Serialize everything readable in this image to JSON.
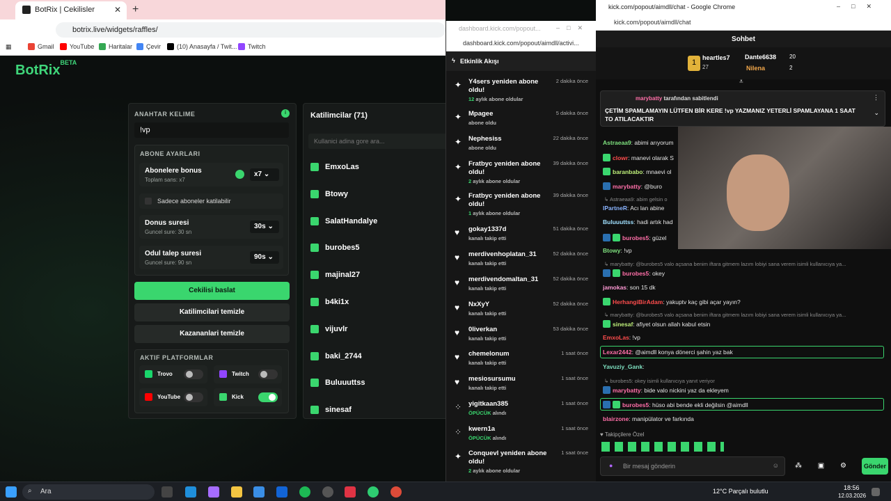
{
  "left": {
    "tab_title": "BotRix | Cekilisler",
    "url": "botrix.live/widgets/raffles/",
    "bookmarks": [
      "Gmail",
      "YouTube",
      "Haritalar",
      "Çevir",
      "(10) Anasayfa / Twit...",
      "Twitch"
    ],
    "logo": "BotRix",
    "logo_sup": "BETA",
    "keyword_label": "ANAHTAR KELIME",
    "keyword_value": "!vp",
    "sub_settings_label": "ABONE AYARLARI",
    "sub_bonus": "Abonelere bonus",
    "sub_bonus_sub": "Toplam sans: x7",
    "sub_bonus_val": "x7",
    "sub_only": "Sadece aboneler katilabilir",
    "duration": "Donus suresi",
    "duration_sub": "Guncel sure: 30 sn",
    "duration_val": "30s",
    "claim": "Odul talep suresi",
    "claim_sub": "Guncel sure: 90 sn",
    "claim_val": "90s",
    "start_btn": "Cekilisi baslat",
    "clear_parts": "Katilimcilari temizle",
    "clear_winners": "Kazananlari temizle",
    "platforms_label": "AKTIF PLATFORMLAR",
    "platforms": [
      {
        "name": "Trovo",
        "on": false
      },
      {
        "name": "Twitch",
        "on": false
      },
      {
        "name": "YouTube",
        "on": false
      },
      {
        "name": "Kick",
        "on": true
      }
    ],
    "participants_title": "Katilimcilar (71)",
    "participants_search": "Kullanici adina gore ara...",
    "participants": [
      "EmxoLas",
      "Btowy",
      "SalatHandalye",
      "burobes5",
      "majinal27",
      "b4ki1x",
      "vijuvlr",
      "baki_2744",
      "Buluuuttss",
      "sinesaf"
    ]
  },
  "activity": {
    "title_bar": "dashboard.kick.com/popout...",
    "url": "dashboard.kick.com/popout/aimdll/activi...",
    "header": "Etkinlik Akışı",
    "events": [
      {
        "icon": "✦",
        "name": "Y4sers yeniden abone oldu!",
        "sub": "12",
        "sub_text": " aylık abone oldular",
        "time": "2 dakika önce"
      },
      {
        "icon": "✦",
        "name": "Mpagee",
        "sub": "",
        "sub_text": "abone oldu",
        "time": "5 dakika önce"
      },
      {
        "icon": "✦",
        "name": "Nephesiss",
        "sub": "",
        "sub_text": "abone oldu",
        "time": "22 dakika önce"
      },
      {
        "icon": "✦",
        "name": "Fratbyc yeniden abone oldu!",
        "sub": "2",
        "sub_text": " aylık abone oldular",
        "time": "39 dakika önce"
      },
      {
        "icon": "✦",
        "name": "Fratbyc yeniden abone oldu!",
        "sub": "1",
        "sub_text": " aylık abone oldular",
        "time": "39 dakika önce"
      },
      {
        "icon": "♥",
        "name": "gokay1337d",
        "sub": "",
        "sub_text": "kanalı takip etti",
        "time": "51 dakika önce"
      },
      {
        "icon": "♥",
        "name": "merdivenhoplatan_31",
        "sub": "",
        "sub_text": "kanalı takip etti",
        "time": "52 dakika önce"
      },
      {
        "icon": "♥",
        "name": "merdivendomaltan_31",
        "sub": "",
        "sub_text": "kanalı takip etti",
        "time": "52 dakika önce"
      },
      {
        "icon": "♥",
        "name": "NxXyY",
        "sub": "",
        "sub_text": "kanalı takip etti",
        "time": "52 dakika önce"
      },
      {
        "icon": "♥",
        "name": "0liverkan",
        "sub": "",
        "sub_text": "kanalı takip etti",
        "time": "53 dakika önce"
      },
      {
        "icon": "♥",
        "name": "chemelonum",
        "sub": "",
        "sub_text": "kanalı takip etti",
        "time": "1 saat önce"
      },
      {
        "icon": "♥",
        "name": "mesiosursumu",
        "sub": "",
        "sub_text": "kanalı takip etti",
        "time": "1 saat önce"
      },
      {
        "icon": "⁘",
        "name": "yigitkaan385",
        "sub": "ÖPÜCÜK",
        "sub_text": " alındı",
        "time": "1 saat önce"
      },
      {
        "icon": "⁘",
        "name": "kwern1a",
        "sub": "ÖPÜCÜK",
        "sub_text": " alındı",
        "time": "1 saat önce"
      },
      {
        "icon": "✦",
        "name": "Conquevl yeniden abone oldu!",
        "sub": "2",
        "sub_text": " aylık abone oldular",
        "time": "1 saat önce"
      }
    ]
  },
  "chat": {
    "title_bar": "kick.com/popout/aimdll/chat - Google Chrome",
    "url": "kick.com/popout/aimdll/chat",
    "header": "Sohbet",
    "leader1": "heartles7",
    "leader1_n": "27",
    "leader2": "Dante6638",
    "leader2_n": "20",
    "leader3": "Nilena",
    "leader3_n": "2",
    "pinned_by": "marybatty",
    "pinned_suffix": "tarafından sabitlendi",
    "pinned_text": "ÇETİM SPAMLAMAYIN LÜTFEN BİR KERE !vp YAZMANIZ YETERLİ SPAMLAYANA 1 SAAT TO ATILACAKTIR",
    "messages": [
      {
        "user": "Astraeaa9",
        "color": "#7ee07e",
        "text": ": abimi arıyorum",
        "badge": ""
      },
      {
        "user": "clowr",
        "color": "#ff4d4d",
        "text": ": manevi olarak S",
        "badge": "g"
      },
      {
        "user": "baranbabo",
        "color": "#bff07a",
        "text": ": mnaevi ol",
        "badge": "g"
      },
      {
        "user": "marybatty",
        "color": "#ff6fa8",
        "text": ": @buro",
        "badge": "b"
      },
      {
        "user": "",
        "color": "",
        "text": "↳ Astraeaa9: abim gelsin o",
        "badge": "reply"
      },
      {
        "user": "lPartneR",
        "color": "#8ab4ff",
        "text": ": Acı lan abine",
        "badge": ""
      },
      {
        "user": "Buluuuttss",
        "color": "#a0e0ff",
        "text": ": hadi artık had",
        "badge": ""
      },
      {
        "user": "burobes5",
        "color": "#ff6fa8",
        "text": ": güzel",
        "badge": "bg"
      },
      {
        "user": "Btowy",
        "color": "#7ee07e",
        "text": ": !vp",
        "badge": ""
      },
      {
        "user": "",
        "color": "",
        "text": "↳ marybatty: @burobes5 valo açsana benim iftara gitmem lazım lobiyi sana verem isimli kullanıcıya ya...",
        "badge": "reply"
      },
      {
        "user": "burobes5",
        "color": "#ff6fa8",
        "text": ": okey",
        "badge": "bg"
      },
      {
        "user": "jamokas",
        "color": "#ff9ad5",
        "text": ": son 15 dk",
        "badge": ""
      },
      {
        "user": "HerhangiBirAdam",
        "color": "#ff4d4d",
        "text": ": yakuptv kaç gibi açar yayın?",
        "badge": "g"
      },
      {
        "user": "",
        "color": "",
        "text": "↳ marybatty: @burobes5 valo açsana benim iftara gitmem lazım lobiyi sana verem isimli kullanıcıya ya...",
        "badge": "reply"
      },
      {
        "user": "sinesaf",
        "color": "#bff07a",
        "text": ": afiyet olsun allah kabul etsin",
        "badge": "g"
      },
      {
        "user": "EmxoLas",
        "color": "#ff4d4d",
        "text": ": !vp",
        "badge": ""
      },
      {
        "user": "Lexar2442",
        "color": "#ff6fa8",
        "text": ": @aimdll konya dönerci şahin yaz bak",
        "badge": "hl"
      },
      {
        "user": "Yavuziy_Gank",
        "color": "#7ee0c0",
        "text": ":",
        "badge": ""
      },
      {
        "user": "",
        "color": "",
        "text": "↳ burobes5: okey isimli kullanıcıya yanıt veriyor",
        "badge": "reply"
      },
      {
        "user": "marybatty",
        "color": "#ff6fa8",
        "text": ": bide valo nickini yaz da ekleyem",
        "badge": "b"
      },
      {
        "user": "burobes5",
        "color": "#ff6fa8",
        "text": ": hüso abi bende ekli değilsin @aimdll",
        "badge": "bghl"
      },
      {
        "user": "blairzone",
        "color": "#ff6fa8",
        "text": ": manipülator ve farkında",
        "badge": ""
      }
    ],
    "followers_label": "Takipçilere Özel",
    "input_placeholder": "Bir mesaj gönderin",
    "send": "Gönder"
  },
  "taskbar": {
    "search": "Ara",
    "weather": "12°C  Parçalı bulutlu",
    "time": "18:56",
    "date": "12.03.2026"
  }
}
